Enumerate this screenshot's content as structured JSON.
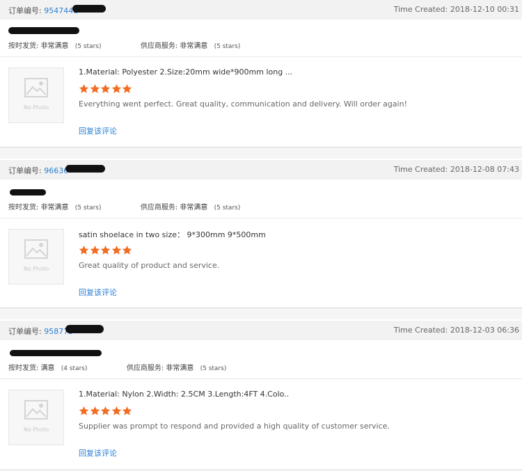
{
  "orders": [
    {
      "order_label": "订单编号:",
      "order_number": "9547448",
      "time_created": "Time Created: 2018-12-10 00:31",
      "ratings": {
        "delivery_label": "按时发货:",
        "delivery_value": "非常满意",
        "delivery_stars": "(5 stars)",
        "service_label": "供应商服务:",
        "service_value": "非常满意",
        "service_stars": "(5 stars)"
      },
      "no_photo": "No Photo",
      "product_title": "1.Material: Polyester 2.Size:20mm wide*900mm long ...",
      "stars": 5,
      "comment": "Everything went perfect. Great quality, communication and delivery. Will order again!",
      "reply_label": "回复该评论"
    },
    {
      "order_label": "订单编号:",
      "order_number": "96636",
      "time_created": "Time Created: 2018-12-08 07:43",
      "ratings": {
        "delivery_label": "按时发货:",
        "delivery_value": "非常满意",
        "delivery_stars": "(5 stars)",
        "service_label": "供应商服务:",
        "service_value": "非常满意",
        "service_stars": "(5 stars)"
      },
      "no_photo": "No Photo",
      "product_title": "satin shoelace in two size： 9*300mm 9*500mm",
      "stars": 5,
      "comment": "Great quality of product and service.",
      "reply_label": "回复该评论"
    },
    {
      "order_label": "订单编号:",
      "order_number": "958773",
      "time_created": "Time Created: 2018-12-03 06:36",
      "ratings": {
        "delivery_label": "按时发货:",
        "delivery_value": "满意",
        "delivery_stars": "(4 stars)",
        "service_label": "供应商服务:",
        "service_value": "非常满意",
        "service_stars": "(5 stars)"
      },
      "no_photo": "No Photo",
      "product_title": "1.Material: Nylon 2.Width: 2.5CM 3.Length:4FT 4.Colo..",
      "stars": 5,
      "comment": "Supplier was prompt to respond and provided a high quality of customer service.",
      "reply_label": "回复该评论"
    }
  ],
  "colors": {
    "accent_link": "#2a7fd4",
    "star": "#f26c22",
    "header_bg": "#f2f2f2"
  },
  "icons": {
    "thumbnail_placeholder": "image-placeholder-icon",
    "star": "star-icon"
  }
}
